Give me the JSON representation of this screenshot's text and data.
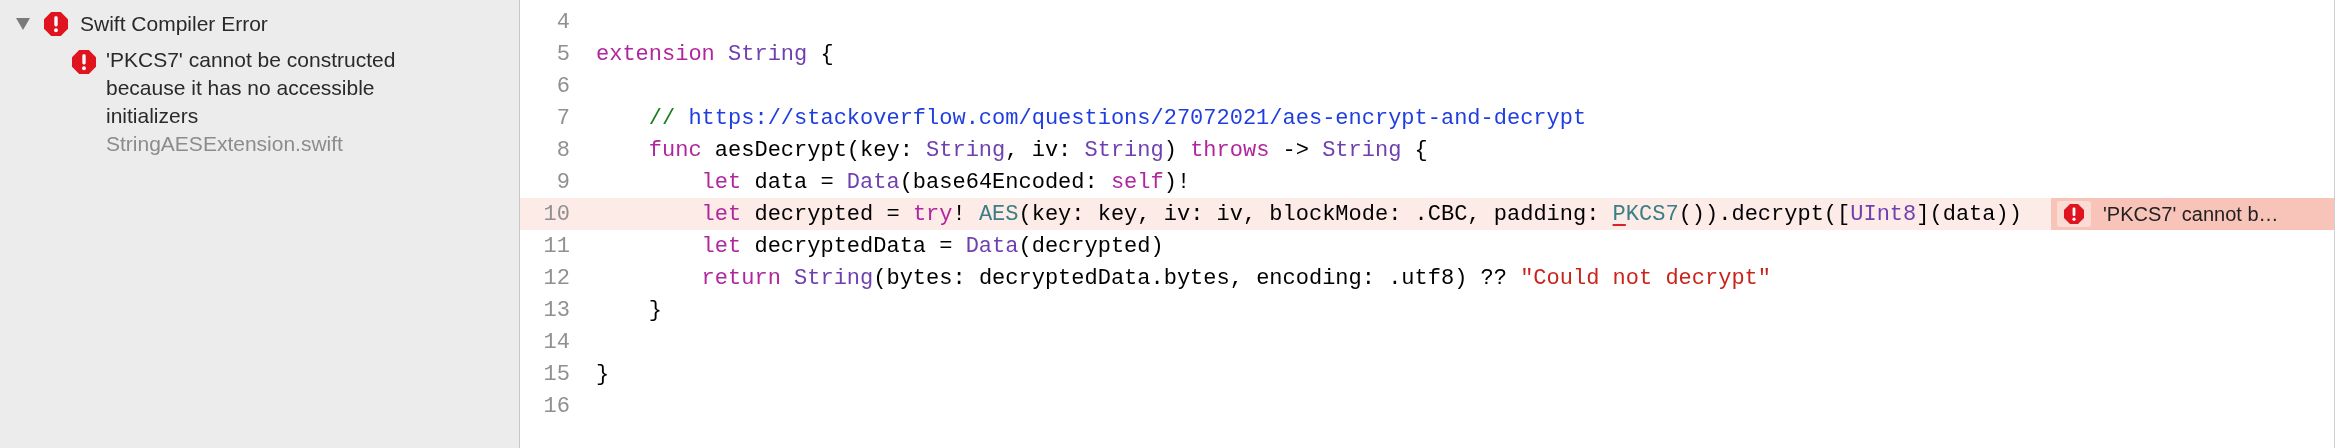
{
  "issue_navigator": {
    "groups": [
      {
        "title": "Swift Compiler Error",
        "expanded": true,
        "children": [
          {
            "message": "'PKCS7' cannot be constructed because it has no accessible initializers",
            "file": "StringAESExtension.swift"
          }
        ]
      }
    ]
  },
  "editor": {
    "lines": [
      {
        "number": "4",
        "highlighted": false
      },
      {
        "number": "5",
        "highlighted": false,
        "tokens": [
          {
            "text": "extension",
            "kind": "keyword"
          },
          {
            "text": " String",
            "kind": "type"
          },
          {
            "text": " {",
            "kind": "plain"
          }
        ]
      },
      {
        "number": "6",
        "highlighted": false
      },
      {
        "number": "7",
        "highlighted": false,
        "tokens": [
          {
            "text": "    // ",
            "kind": "comment"
          },
          {
            "text": "https://stackoverflow.com/questions/27072021/aes-encrypt-and-decrypt",
            "kind": "url"
          }
        ]
      },
      {
        "number": "8",
        "highlighted": false,
        "tokens": [
          {
            "text": "    func",
            "kind": "keyword"
          },
          {
            "text": " aesDecrypt(key: ",
            "kind": "plain"
          },
          {
            "text": "String",
            "kind": "type"
          },
          {
            "text": ", iv: ",
            "kind": "plain"
          },
          {
            "text": "String",
            "kind": "type"
          },
          {
            "text": ") ",
            "kind": "plain"
          },
          {
            "text": "throws",
            "kind": "keyword"
          },
          {
            "text": " -> ",
            "kind": "plain"
          },
          {
            "text": "String",
            "kind": "type"
          },
          {
            "text": " {",
            "kind": "plain"
          }
        ]
      },
      {
        "number": "9",
        "highlighted": false,
        "tokens": [
          {
            "text": "        let",
            "kind": "keyword"
          },
          {
            "text": " data = ",
            "kind": "plain"
          },
          {
            "text": "Data",
            "kind": "type"
          },
          {
            "text": "(base64Encoded: ",
            "kind": "plain"
          },
          {
            "text": "self",
            "kind": "keyword"
          },
          {
            "text": ")!",
            "kind": "plain"
          }
        ]
      },
      {
        "number": "10",
        "highlighted": true,
        "tokens": [
          {
            "text": "        let",
            "kind": "keyword"
          },
          {
            "text": " decrypted = ",
            "kind": "plain"
          },
          {
            "text": "try",
            "kind": "keyword"
          },
          {
            "text": "! ",
            "kind": "plain"
          },
          {
            "text": "AES",
            "kind": "class"
          },
          {
            "text": "(key: key, iv: iv, blockMode: .CBC, padding: ",
            "kind": "plain"
          },
          {
            "text": "P",
            "kind": "class_error"
          },
          {
            "text": "KCS7",
            "kind": "class"
          },
          {
            "text": "()).decrypt([",
            "kind": "plain"
          },
          {
            "text": "UInt8",
            "kind": "type"
          },
          {
            "text": "](data))",
            "kind": "plain"
          }
        ],
        "issue": "'PKCS7' cannot b…"
      },
      {
        "number": "11",
        "highlighted": false,
        "tokens": [
          {
            "text": "        let",
            "kind": "keyword"
          },
          {
            "text": " decryptedData = ",
            "kind": "plain"
          },
          {
            "text": "Data",
            "kind": "type"
          },
          {
            "text": "(decrypted)",
            "kind": "plain"
          }
        ]
      },
      {
        "number": "12",
        "highlighted": false,
        "tokens": [
          {
            "text": "        return",
            "kind": "keyword"
          },
          {
            "text": " String",
            "kind": "type"
          },
          {
            "text": "(bytes: decryptedData.bytes, encoding: .utf8) ?? ",
            "kind": "plain"
          },
          {
            "text": "\"Could not decrypt\"",
            "kind": "string"
          }
        ]
      },
      {
        "number": "13",
        "highlighted": false,
        "tokens": [
          {
            "text": "    }",
            "kind": "plain"
          }
        ]
      },
      {
        "number": "14",
        "highlighted": false
      },
      {
        "number": "15",
        "highlighted": false,
        "tokens": [
          {
            "text": "}",
            "kind": "plain"
          }
        ]
      },
      {
        "number": "16",
        "highlighted": false
      }
    ]
  }
}
